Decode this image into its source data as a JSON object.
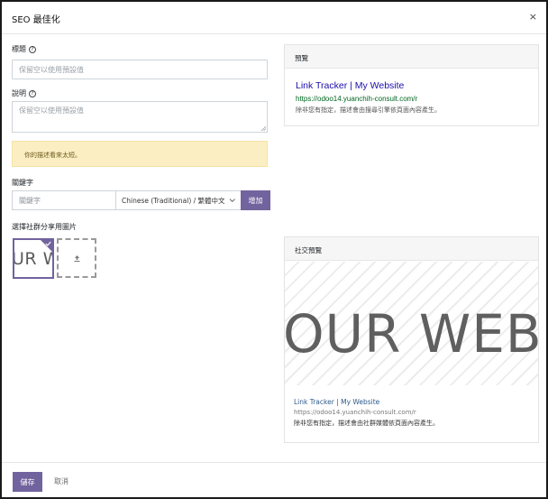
{
  "dialog": {
    "title": "SEO 最佳化",
    "close_glyph": "×"
  },
  "form": {
    "title_label": "標題",
    "title_placeholder": "保留空以使用預設值",
    "description_label": "說明",
    "description_placeholder": "保留空以使用預設值",
    "alert_text": "你的描述看來太短。",
    "keywords_label": "關鍵字",
    "keyword_placeholder": "關鍵字",
    "language_selected": "Chinese (Traditional) / 繁體中文",
    "add_button": "增加",
    "social_image_label": "選擇社群分享用圖片",
    "thumbnail_text": "UR W",
    "help_glyph": "?"
  },
  "preview": {
    "header": "預覽",
    "title": "Link Tracker | My Website",
    "url": "https://odoo14.yuanchih-consult.com/r",
    "description": "除非您有指定，描述會由搜尋引擎依頁面內容產生。"
  },
  "social_preview": {
    "header": "社交預覽",
    "banner_text": "OUR WEB",
    "title": "Link Tracker | My Website",
    "url": "https://odoo14.yuanchih-consult.com/r",
    "description": "除非您有指定，描述會由社群媒體依頁面內容產生。"
  },
  "footer": {
    "save_button": "儲存",
    "cancel_button": "取消"
  },
  "colors": {
    "primary": "#71639e",
    "alert_bg": "#fbeec3",
    "link_title": "#1a0dab",
    "link_url": "#006621"
  },
  "icons": {
    "close": "close-icon",
    "help": "help-icon",
    "chevron": "chevron-down-icon",
    "upload": "upload-icon",
    "check": "check-icon"
  }
}
